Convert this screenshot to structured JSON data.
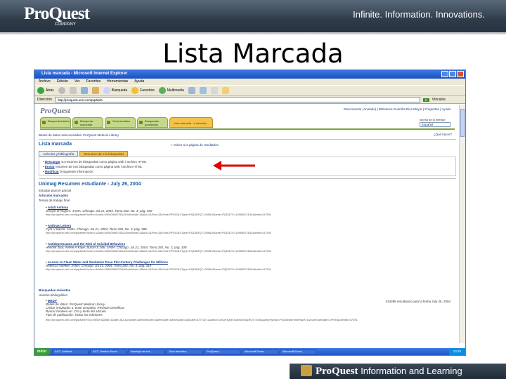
{
  "slide": {
    "logo": "ProQuest",
    "logo_sub": "COMPANY",
    "tagline": "Infinite. Information. Innovations.",
    "title": "Lista Marcada",
    "footer_brand": "ProQuest",
    "footer_rest": "Information and Learning"
  },
  "browser": {
    "window_title": "Lista marcada - Microsoft Internet Explorer",
    "menu": [
      "Archivo",
      "Edición",
      "Ver",
      "Favoritos",
      "Herramientas",
      "Ayuda"
    ],
    "toolbar": [
      "Atrás",
      "Búsqueda",
      "Favoritos",
      "Multimedia"
    ],
    "address_label": "Dirección",
    "address_value": "http://proquest.umi.com/pqdweb",
    "go_label": "Ir",
    "vinculos": "Vínculos"
  },
  "page": {
    "logo": "ProQuest",
    "top_links": "Desconectar (Anulado) | Biblioteca Guerrilla Dios Mayor | Preguntas | Ayuda",
    "lang_label": "Idioma de la interfaz:",
    "lang_value": "Español",
    "nav_tabs": [
      "Búsqueda básica",
      "Búsqueda avanzada",
      "Guía temática",
      "Búsquedas guardadas"
    ],
    "marked_tab": "Lista marcada : 4 artículos",
    "breadcrumb": "Bases de datos seleccionadas: ProQuest Medical Library",
    "help_link": "¿Qué hacer?",
    "list_title": "Lista marcada",
    "back_link": "« Volver a la página de resultados",
    "subtabs": [
      "Artículos y bibliografía",
      "Resumen de mis búsquedas"
    ],
    "actions": [
      {
        "label": "Descargar",
        "text": "su resumen de búsquedas como página web / archivo HTML"
      },
      {
        "label": "Enviar",
        "text": "resumen de mis búsquedas como página web / archivo HTML"
      },
      {
        "label": "Modificar",
        "text": "la siguiente información"
      }
    ],
    "summary_title": "Unimag Resumen estudiante - July 26, 2004",
    "lines": [
      "Estudiar para el parcial",
      "Artículos marcados",
      "Temas de trabajo final"
    ],
    "articles": [
      {
        "title": "Adult Asthma",
        "meta": "Joseph M Rogers. JAMA. Chicago: Jul 21, 2004. Tomo 292, No. 3; pág. 400",
        "url": "http://proquest.umi.com/pqdweb?index=0&did=000000667061&SrchMode=3&sid=1&Fmt=3&VInst=PROD&VType=PQD&RQT=309&VName=PQD&TS=1090857118&clientId=57391"
      },
      {
        "title": "Anthrax Letters",
        "meta": "Cyril H Wecht. JAMA. Chicago: Jul 21, 2004. Tomo 292, No. 3; pág. 388",
        "url": "http://proquest.umi.com/pqdweb?index=1&did=000000667051&SrchMode=3&sid=1&Fmt=3&VInst=PROD&VType=PQD&RQT=309&VName=PQD&TS=1090857118&clientId=57391"
      },
      {
        "title": "Antidepressants and the Risk of Suicidal Behaviors",
        "meta": "Hendrik Juur, Aimee A Kaye, Susan S Jick. JAMA. Chicago: Jul 21, 2004. Tomo 292, No. 3; pág. 338",
        "url": "http://proquest.umi.com/pqdweb?index=2&did=000000667061&SrchMode=3&sid=1&Fmt=3&VInst=PROD&VType=PQD&RQT=309&VName=PQD&TS=1090857118&clientId=57391"
      },
      {
        "title": "Access to Clean Water and Sanitation Pose Plot Century Challenges for Millions",
        "meta": "Rebecca Voelker. JAMA. Chicago: Jul 21, 2004. Tomo 292, No. 3; pág. 319",
        "url": "http://proquest.umi.com/pqdweb?index=3&did=000000667031&SrchMode=3&sid=1&Fmt=3&VInst=PROD&VType=PQD&RQT=309&VName=PQD&TS=1090857118&clientId=57391"
      }
    ],
    "searches_header": "Búsquedas recientes",
    "searches_sub": "revisión bibliográfica",
    "search": {
      "title": "MEDI*",
      "count": "434398 resultados para la fecha July 26, 2004",
      "lines": [
        "Bases de datos: ProQuest Medical Library",
        "Limitar resultados a: texto completo, Revistas científicas",
        "Buscar también en: Cita y texto del artículo",
        "Tipo de publicación: Todas las ediciones"
      ],
      "url": "http://proquest.umi.com/pqdweb?SQ=MEDI*&DBId=&date=ALL&onDate=&beforeDate=&afterDate=&fromDate=&toDate=&TITLE=&author=&SortType=DateDesc&RQT=305&querySyntax=PQ&searchInterface=1&moreOptState=OPEN&clientId=57391"
    }
  },
  "taskbar": {
    "start": "Inicio",
    "tasks": [
      "ACT. Unilibrol...",
      "ACT. Gestión Excel",
      "Bandeja de ent...",
      "Guía temática",
      "ProQuest...",
      "Microsoft Powe...",
      "Microsoft Excel..."
    ],
    "clock": "10:25"
  },
  "colors": {
    "header_dark": "#2f3c4a",
    "link_blue": "#1a3a8a",
    "title_blue": "#1a5a9a",
    "tab_green": "#c6d98a",
    "marked_orange": "#f2c24a",
    "arrow_red": "#e00000"
  }
}
